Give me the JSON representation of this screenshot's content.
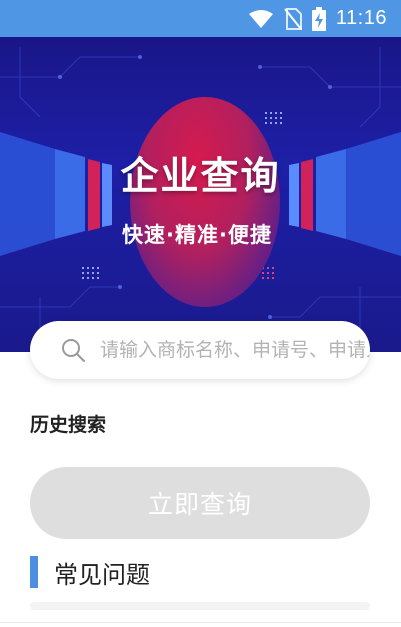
{
  "status_bar": {
    "time": "11:16",
    "icons": [
      "wifi-icon",
      "no-sim-icon",
      "battery-charging-icon"
    ]
  },
  "banner": {
    "title": "企业查询",
    "subtitle": "快速·精准·便捷"
  },
  "search": {
    "placeholder": "请输入商标名称、申请号、申请人",
    "value": "",
    "icon": "search-icon"
  },
  "history": {
    "title": "历史搜索"
  },
  "actions": {
    "query_label": "立即查询"
  },
  "faq": {
    "title": "常见问题"
  },
  "colors": {
    "status_bar": "#4f97e4",
    "banner_bg": "#1d1fa6",
    "accent": "#4b8fe0",
    "button_disabled": "#dedede"
  }
}
